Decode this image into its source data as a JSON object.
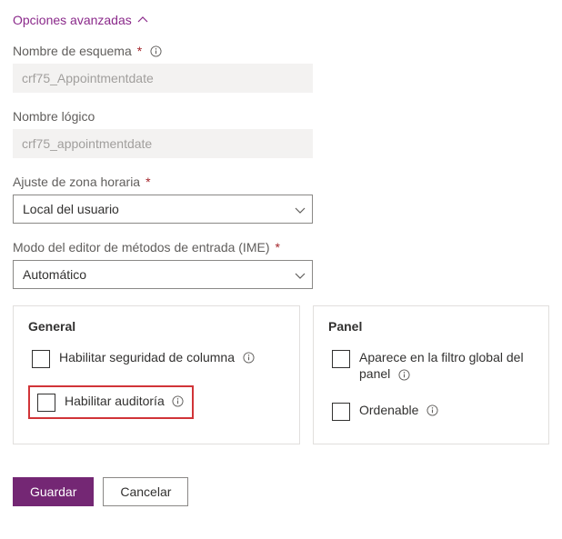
{
  "header": {
    "advanced_options": "Opciones avanzadas"
  },
  "fields": {
    "schema_name": {
      "label": "Nombre de esquema",
      "value": "crf75_Appointmentdate"
    },
    "logical_name": {
      "label": "Nombre lógico",
      "value": "crf75_appointmentdate"
    },
    "timezone": {
      "label": "Ajuste de zona horaria",
      "value": "Local del usuario"
    },
    "ime_mode": {
      "label": "Modo del editor de métodos de entrada (IME)",
      "value": "Automático"
    }
  },
  "panels": {
    "general": {
      "title": "General",
      "column_security": "Habilitar seguridad de columna",
      "enable_audit": "Habilitar auditoría"
    },
    "panel": {
      "title": "Panel",
      "global_filter": "Aparece en la filtro global del panel",
      "sortable": "Ordenable"
    }
  },
  "buttons": {
    "save": "Guardar",
    "cancel": "Cancelar"
  }
}
